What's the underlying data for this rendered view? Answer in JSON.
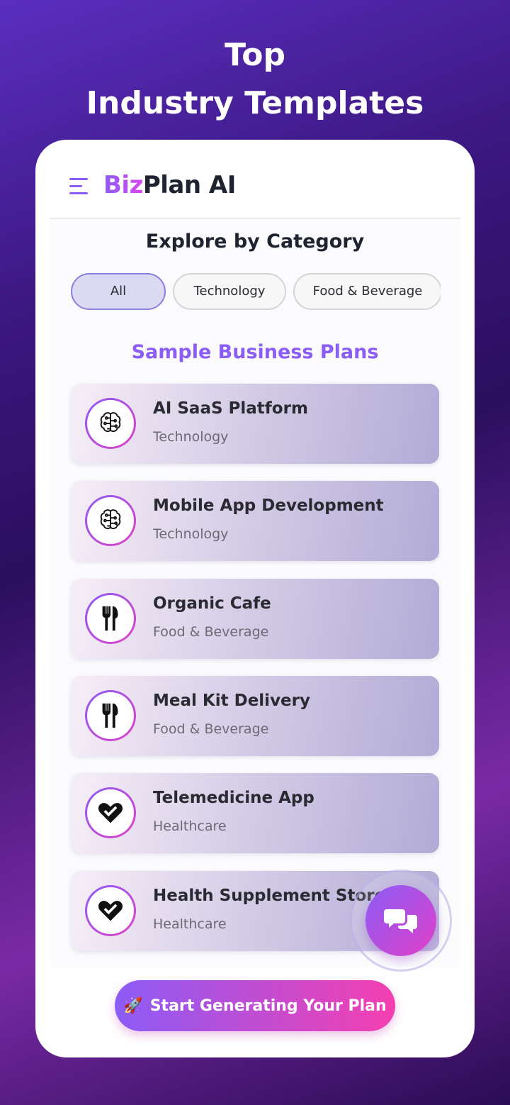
{
  "hero": {
    "line1": "Top",
    "line2": "Industry Templates"
  },
  "header": {
    "brand_part1": "Biz",
    "brand_part2": "Plan AI"
  },
  "explore": {
    "title": "Explore by Category",
    "chips": [
      "All",
      "Technology",
      "Food & Beverage"
    ]
  },
  "plans": {
    "title": "Sample Business Plans",
    "items": [
      {
        "title": "AI SaaS Platform",
        "category": "Technology",
        "icon": "brain-icon"
      },
      {
        "title": "Mobile App Development",
        "category": "Technology",
        "icon": "brain-icon"
      },
      {
        "title": "Organic Cafe",
        "category": "Food & Beverage",
        "icon": "utensils-icon"
      },
      {
        "title": "Meal Kit Delivery",
        "category": "Food & Beverage",
        "icon": "utensils-icon"
      },
      {
        "title": "Telemedicine App",
        "category": "Healthcare",
        "icon": "heart-icon"
      },
      {
        "title": "Health Supplement Store",
        "category": "Healthcare",
        "icon": "heart-icon"
      }
    ]
  },
  "cta": {
    "icon": "🚀",
    "label": "Start Generating Your Plan"
  },
  "colors": {
    "accent": "#8b5cf6",
    "accent2": "#e040c8",
    "text": "#1f2330"
  }
}
